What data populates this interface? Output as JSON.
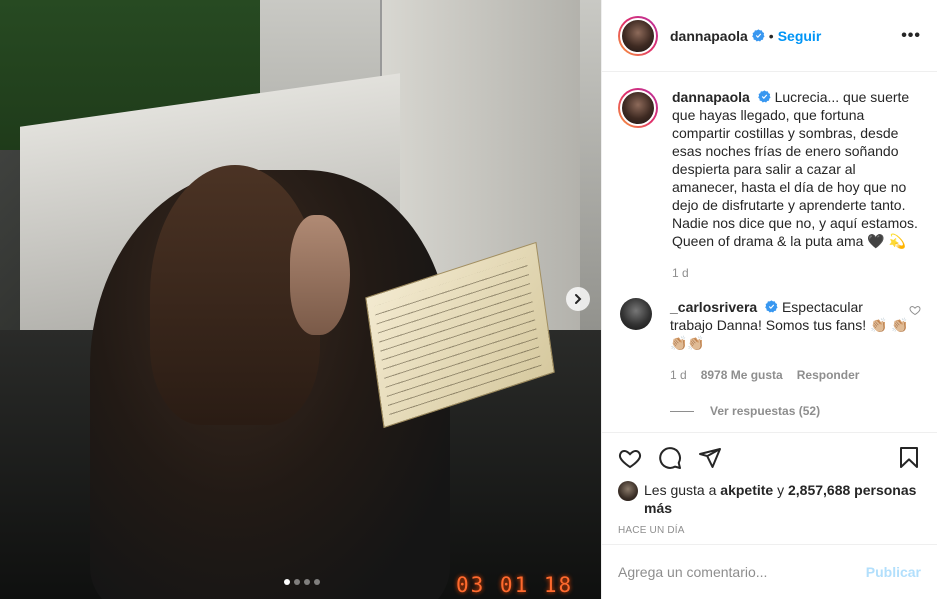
{
  "post": {
    "date_stamp": "03 01 18",
    "carousel": {
      "slides": 4,
      "active": 1
    }
  },
  "header": {
    "username": "dannapaola",
    "separator": "•",
    "follow_label": "Seguir",
    "more_label": "•••"
  },
  "caption": {
    "username": "dannapaola",
    "text": "Lucrecia... que suerte que hayas llegado, que fortuna compartir costillas y sombras, desde esas noches frías de enero soñando despierta para salir a cazar al amanecer, hasta el día de hoy que no dejo de disfrutarte y aprenderte tanto. Nadie nos dice que no, y aquí estamos. Queen of drama & la puta ama 🖤 💫",
    "time": "1 d"
  },
  "comment": {
    "username": "_carlosrivera",
    "text": "Espectacular trabajo Danna! Somos tus fans! 👏🏼 👏🏼👏🏼👏🏼",
    "time": "1 d",
    "likes": "8978 Me gusta",
    "reply_label": "Responder",
    "view_replies": "Ver respuestas (52)"
  },
  "likes": {
    "prefix": "Les gusta a",
    "user": "akpetite",
    "conj": "y",
    "count": "2,857,688 personas más"
  },
  "timestamp": "HACE UN DÍA",
  "add_comment": {
    "placeholder": "Agrega un comentario...",
    "publish_label": "Publicar"
  },
  "colors": {
    "accent": "#0095f6",
    "publish_disabled": "#b2dffc",
    "date_stamp": "#ff6a2e"
  },
  "icons": [
    "verified-icon",
    "more-icon",
    "heart-icon",
    "comment-icon",
    "share-icon",
    "save-icon",
    "chevron-right-icon"
  ]
}
